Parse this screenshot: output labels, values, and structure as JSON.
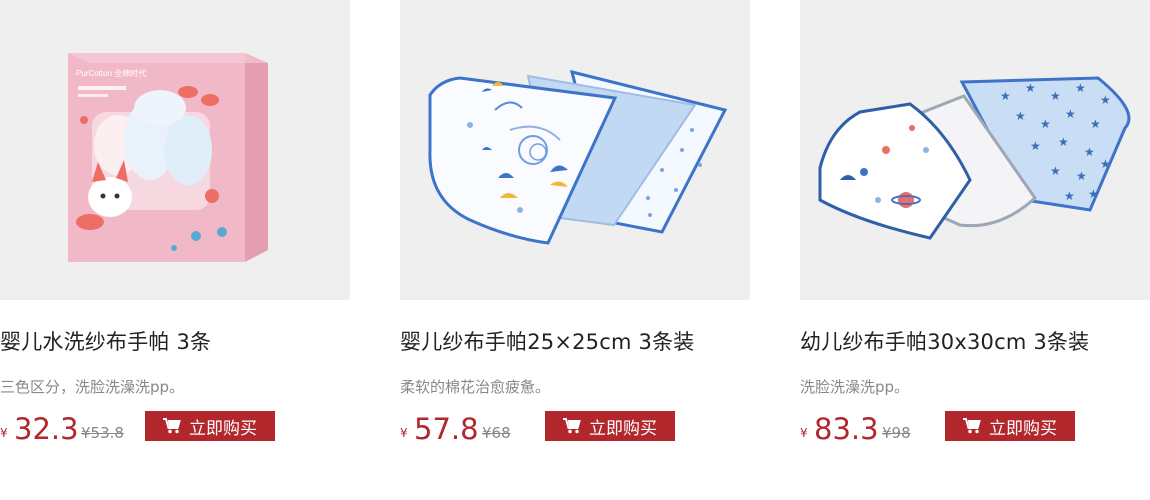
{
  "products": [
    {
      "title": "婴儿水洗纱布手帕 3条",
      "desc": "三色区分，洗脸洗澡洗pp。",
      "currency": "¥",
      "price": "32.3",
      "old_price": "¥53.8",
      "buy_label": "立即购买",
      "image_icon": "pink-box-handkerchief-image",
      "package_brand": "PurCotton 全棉时代"
    },
    {
      "title": "婴儿纱布手帕25×25cm  3条装",
      "desc": "柔软的棉花治愈疲惫。",
      "currency": "¥",
      "price": "57.8",
      "old_price": "¥68",
      "buy_label": "立即购买",
      "image_icon": "folded-blue-handkerchiefs-image"
    },
    {
      "title": "幼儿纱布手帕30x30cm  3条装",
      "desc": "洗脸洗澡洗pp。",
      "currency": "¥",
      "price": "83.3",
      "old_price": "¥98",
      "buy_label": "立即购买",
      "image_icon": "star-handkerchiefs-image"
    }
  ],
  "colors": {
    "accent": "#b1272c",
    "image_bg": "#efefef",
    "muted_text": "#888888"
  },
  "icons": {
    "cart": "shopping-cart-icon"
  }
}
